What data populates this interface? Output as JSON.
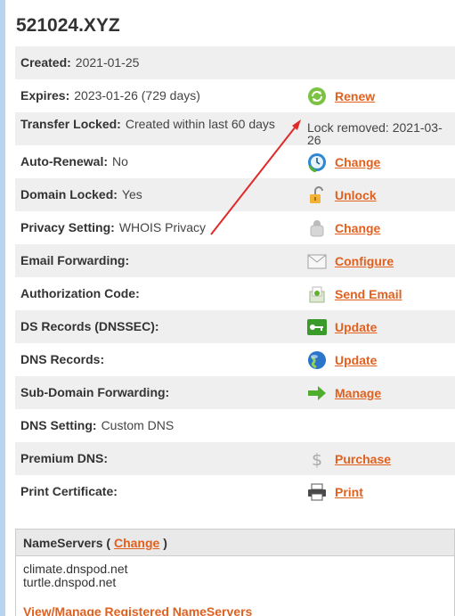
{
  "domain": "521024.XYZ",
  "rows": [
    {
      "label": "Created:",
      "value": "2021-01-25"
    },
    {
      "label": "Expires:",
      "value": "2023-01-26 (729 days)",
      "action": "Renew",
      "icon": "renew-icon"
    },
    {
      "label": "Transfer Locked:",
      "value": "Created within last 60 days",
      "note": "Lock removed: 2021-03-26"
    },
    {
      "label": "Auto-Renewal:",
      "value": "No",
      "action": "Change",
      "icon": "clock-icon"
    },
    {
      "label": "Domain Locked:",
      "value": "Yes",
      "action": "Unlock",
      "icon": "padlock-icon"
    },
    {
      "label": "Privacy Setting:",
      "value": "WHOIS Privacy",
      "action": "Change",
      "icon": "privacy-icon"
    },
    {
      "label": "Email Forwarding:",
      "value": "",
      "action": "Configure",
      "icon": "envelope-icon"
    },
    {
      "label": "Authorization Code:",
      "value": "",
      "action": "Send Email",
      "icon": "mail-icon"
    },
    {
      "label": "DS Records (DNSSEC):",
      "value": "",
      "action": "Update",
      "icon": "key-icon"
    },
    {
      "label": "DNS Records:",
      "value": "",
      "action": "Update",
      "icon": "globe-icon"
    },
    {
      "label": "Sub-Domain Forwarding:",
      "value": "",
      "action": "Manage",
      "icon": "arrow-right-icon"
    },
    {
      "label": "DNS Setting:",
      "value": "Custom DNS"
    },
    {
      "label": "Premium DNS:",
      "value": "",
      "action": "Purchase",
      "icon": "dollar-icon"
    },
    {
      "label": "Print Certificate:",
      "value": "",
      "action": "Print",
      "icon": "printer-icon"
    }
  ],
  "nameservers": {
    "title": "NameServers (",
    "change": "Change",
    "close": ")",
    "servers": [
      "climate.dnspod.net",
      "turtle.dnspod.net"
    ],
    "manage_link": "View/Manage Registered NameServers"
  },
  "colors": {
    "link": "#e2601e",
    "alt_row": "#efefef",
    "annotation_arrow": "#e02a2a"
  }
}
